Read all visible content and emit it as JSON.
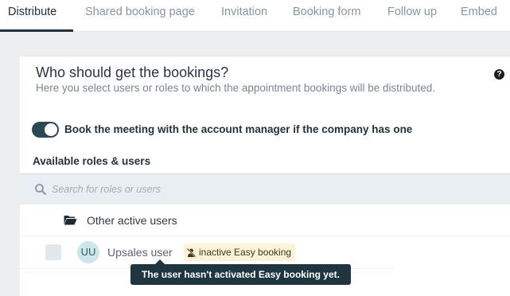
{
  "tabs": [
    {
      "label": "Distribute",
      "active": true
    },
    {
      "label": "Shared booking page",
      "active": false
    },
    {
      "label": "Invitation",
      "active": false
    },
    {
      "label": "Booking form",
      "active": false
    },
    {
      "label": "Follow up",
      "active": false
    },
    {
      "label": "Embed",
      "active": false
    }
  ],
  "panel": {
    "title": "Who should get the bookings?",
    "subtitle": "Here you select users or roles to which the appointment bookings will be distributed.",
    "help_glyph": "?"
  },
  "toggle": {
    "on": true,
    "label": "Book the meeting with the account manager if the company has one"
  },
  "roles": {
    "heading": "Available roles & users",
    "search_placeholder": "Search for roles or users",
    "group_label": "Other active users",
    "users": [
      {
        "initials": "UU",
        "name": "Upsales user",
        "checked": false,
        "badge": "inactive Easy booking"
      }
    ]
  },
  "tooltip": {
    "text": "The user hasn't activated Easy booking yet."
  },
  "colors": {
    "accent": "#23303a",
    "toggle_on": "#2c4855",
    "badge_bg": "#fdf3d8",
    "tooltip_bg": "#1f3540"
  }
}
